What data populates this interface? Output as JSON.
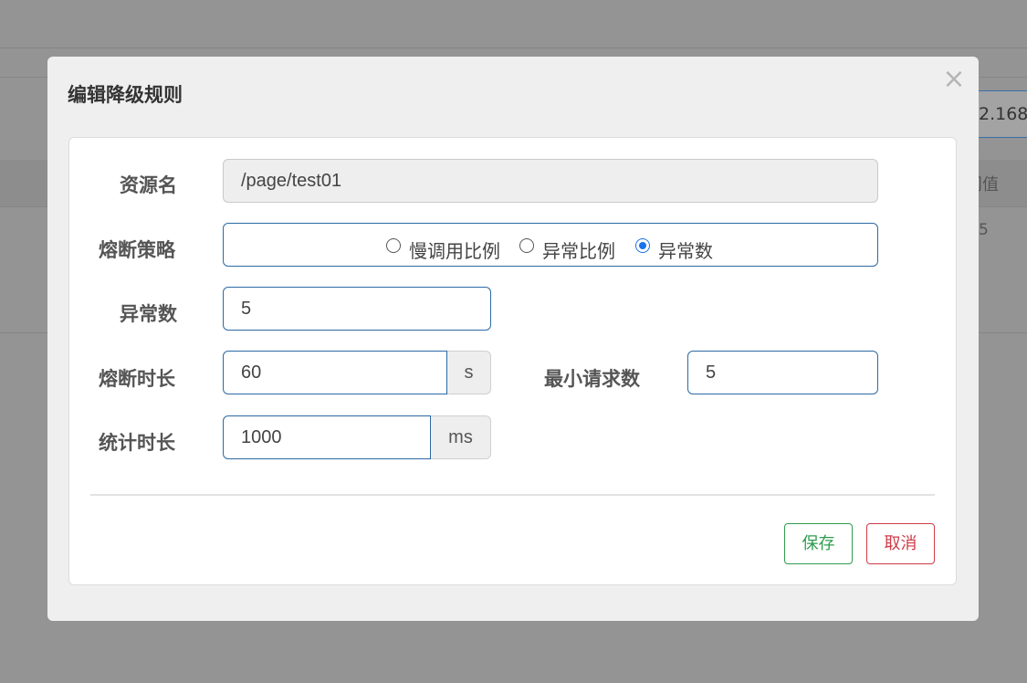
{
  "background": {
    "ip_fragment": "2.168.",
    "column_header_fragment": "阈值",
    "row_value_fragment": "5"
  },
  "modal": {
    "title": "编辑降级规则",
    "close_icon": "close-icon",
    "form": {
      "resource_label": "资源名",
      "resource_value": "/page/test01",
      "strategy_label": "熔断策略",
      "strategy_options": [
        {
          "label": "慢调用比例",
          "checked": false
        },
        {
          "label": "异常比例",
          "checked": false
        },
        {
          "label": "异常数",
          "checked": true
        }
      ],
      "exception_count_label": "异常数",
      "exception_count_value": "5",
      "break_duration_label": "熔断时长",
      "break_duration_value": "60",
      "break_duration_unit": "s",
      "min_requests_label": "最小请求数",
      "min_requests_value": "5",
      "stat_duration_label": "统计时长",
      "stat_duration_value": "1000",
      "stat_duration_unit": "ms"
    },
    "buttons": {
      "save": "保存",
      "cancel": "取消"
    }
  }
}
